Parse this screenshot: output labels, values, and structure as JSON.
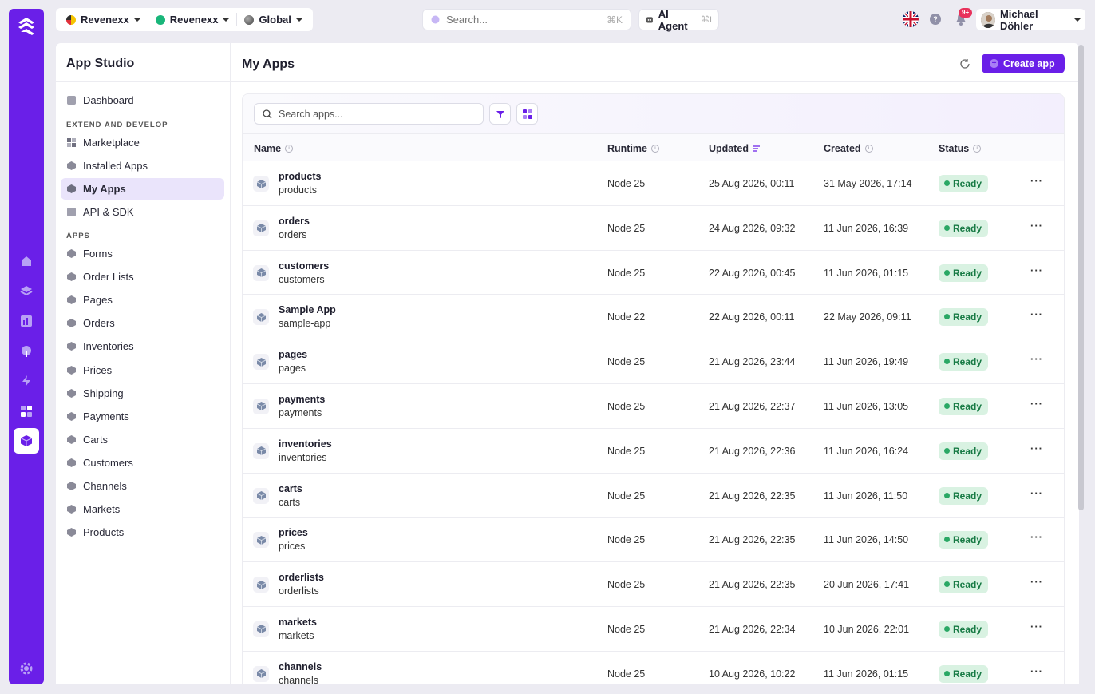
{
  "topbar": {
    "org1": "Revenexx",
    "org2": "Revenexx",
    "scope": "Global",
    "search_placeholder": "Search...",
    "search_shortcut": "⌘K",
    "agent_label": "AI Agent",
    "agent_shortcut": "⌘I",
    "notifications_badge": "9+",
    "user_name": "Michael Döhler"
  },
  "colors": {
    "accent": "#6a1fe8",
    "status_ready_bg": "#d9f2e2",
    "status_ready_text": "#177a44"
  },
  "sidebar": {
    "title": "App Studio",
    "dashboard": "Dashboard",
    "section_extend": "EXTEND AND DEVELOP",
    "extend_items": [
      "Marketplace",
      "Installed Apps",
      "My Apps",
      "API & SDK"
    ],
    "section_apps": "APPS",
    "app_items": [
      "Forms",
      "Order Lists",
      "Pages",
      "Orders",
      "Inventories",
      "Prices",
      "Shipping",
      "Payments",
      "Carts",
      "Customers",
      "Channels",
      "Markets",
      "Products"
    ]
  },
  "main": {
    "title": "My Apps",
    "create_label": "Create app",
    "search_placeholder": "Search apps...",
    "columns": {
      "name": "Name",
      "runtime": "Runtime",
      "updated": "Updated",
      "created": "Created",
      "status": "Status"
    },
    "rows": [
      {
        "title": "products",
        "slug": "products",
        "runtime": "Node 25",
        "updated": "25 Aug 2026, 00:11",
        "created": "31 May 2026, 17:14",
        "status": "Ready"
      },
      {
        "title": "orders",
        "slug": "orders",
        "runtime": "Node 25",
        "updated": "24 Aug 2026, 09:32",
        "created": "11 Jun 2026, 16:39",
        "status": "Ready"
      },
      {
        "title": "customers",
        "slug": "customers",
        "runtime": "Node 25",
        "updated": "22 Aug 2026, 00:45",
        "created": "11 Jun 2026, 01:15",
        "status": "Ready"
      },
      {
        "title": "Sample App",
        "slug": "sample-app",
        "runtime": "Node 22",
        "updated": "22 Aug 2026, 00:11",
        "created": "22 May 2026, 09:11",
        "status": "Ready"
      },
      {
        "title": "pages",
        "slug": "pages",
        "runtime": "Node 25",
        "updated": "21 Aug 2026, 23:44",
        "created": "11 Jun 2026, 19:49",
        "status": "Ready"
      },
      {
        "title": "payments",
        "slug": "payments",
        "runtime": "Node 25",
        "updated": "21 Aug 2026, 22:37",
        "created": "11 Jun 2026, 13:05",
        "status": "Ready"
      },
      {
        "title": "inventories",
        "slug": "inventories",
        "runtime": "Node 25",
        "updated": "21 Aug 2026, 22:36",
        "created": "11 Jun 2026, 16:24",
        "status": "Ready"
      },
      {
        "title": "carts",
        "slug": "carts",
        "runtime": "Node 25",
        "updated": "21 Aug 2026, 22:35",
        "created": "11 Jun 2026, 11:50",
        "status": "Ready"
      },
      {
        "title": "prices",
        "slug": "prices",
        "runtime": "Node 25",
        "updated": "21 Aug 2026, 22:35",
        "created": "11 Jun 2026, 14:50",
        "status": "Ready"
      },
      {
        "title": "orderlists",
        "slug": "orderlists",
        "runtime": "Node 25",
        "updated": "21 Aug 2026, 22:35",
        "created": "20 Jun 2026, 17:41",
        "status": "Ready"
      },
      {
        "title": "markets",
        "slug": "markets",
        "runtime": "Node 25",
        "updated": "21 Aug 2026, 22:34",
        "created": "10 Jun 2026, 22:01",
        "status": "Ready"
      },
      {
        "title": "channels",
        "slug": "channels",
        "runtime": "Node 25",
        "updated": "10 Aug 2026, 10:22",
        "created": "11 Jun 2026, 01:15",
        "status": "Ready"
      }
    ]
  }
}
